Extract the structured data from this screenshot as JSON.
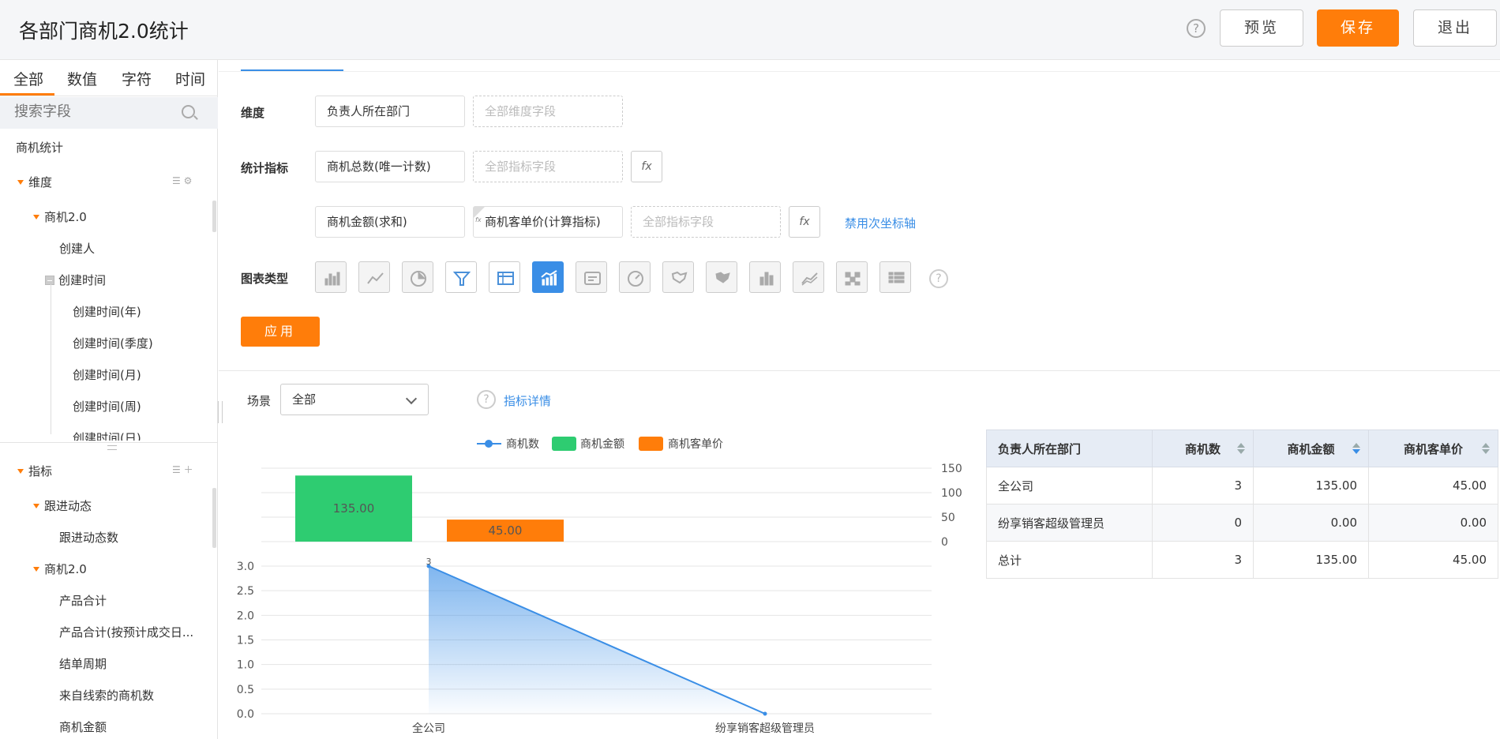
{
  "header": {
    "title": "各部门商机2.0统计",
    "help": "?",
    "preview_label": "预览",
    "save_label": "保存",
    "exit_label": "退出"
  },
  "fields_panel": {
    "tabs": [
      "全部",
      "数值",
      "字符",
      "时间"
    ],
    "search_placeholder": "搜索字段",
    "root": "商机统计",
    "dimension_group": "维度",
    "dim_folder": "商机2.0",
    "dim_items": {
      "creator": "创建人",
      "created_time": "创建时间",
      "ct_year": "创建时间(年)",
      "ct_quarter": "创建时间(季度)",
      "ct_month": "创建时间(月)",
      "ct_week": "创建时间(周)",
      "ct_day": "创建时间(日)"
    },
    "metric_group": "指标",
    "metric_folder_1": "跟进动态",
    "metric_folder_1_items": [
      "跟进动态数"
    ],
    "metric_folder_2": "商机2.0",
    "metric_folder_2_items": [
      "产品合计",
      "产品合计(按预计成交日...",
      "结单周期",
      "来自线索的商机数",
      "商机金额"
    ]
  },
  "config": {
    "dimension_label": "维度",
    "dimension_value": "负责人所在部门",
    "dimension_placeholder": "全部维度字段",
    "metric_label": "统计指标",
    "metric_1": "商机总数(唯一计数)",
    "metric_placeholder": "全部指标字段",
    "metric_2": "商机金额(求和)",
    "metric_3": "商机客单价(计算指标)",
    "fx": "fx",
    "secondary_axis_link": "禁用次坐标轴",
    "chart_type_label": "图表类型",
    "chart_types": [
      "bar-chart-icon",
      "line-chart-icon",
      "pie-chart-icon",
      "funnel-chart-icon",
      "table-chart-icon",
      "combo-chart-icon",
      "card-chart-icon",
      "gauge-chart-icon",
      "map-chart-icon",
      "map2-chart-icon",
      "stacked-bar-icon",
      "area-chart-icon",
      "heatmap-icon",
      "pivot-table-icon"
    ],
    "chart_type_active": "combo-chart-icon",
    "apply_label": "应用"
  },
  "scene": {
    "label": "场景",
    "value": "全部",
    "metric_detail_link": "指标详情"
  },
  "colors": {
    "accent": "#ff7d0a",
    "link": "#3a8ee6",
    "series_count": "#3a8ee6",
    "series_amount": "#2ecc71",
    "series_unit_price": "#ff7d0a"
  },
  "chart_data": {
    "type": "bar",
    "categories": [
      "全公司",
      "纷享销客超级管理员"
    ],
    "series": [
      {
        "name": "商机数",
        "type": "line",
        "values": [
          3,
          0
        ],
        "labels": [
          "3",
          ""
        ]
      },
      {
        "name": "商机金额",
        "type": "bar",
        "values": [
          135.0,
          0.0
        ],
        "labels": [
          "135.00",
          ""
        ]
      },
      {
        "name": "商机客单价",
        "type": "bar",
        "values": [
          45.0,
          0.0
        ],
        "labels": [
          "45.00",
          ""
        ]
      }
    ],
    "bar_axis": {
      "ylim": [
        0,
        150
      ],
      "ticks": [
        "150",
        "100",
        "50",
        "0"
      ]
    },
    "line_axis": {
      "ylim": [
        0,
        3
      ],
      "ticks": [
        "3.0",
        "2.5",
        "2.0",
        "1.5",
        "1.0",
        "0.5",
        "0.0"
      ]
    },
    "legend": "top"
  },
  "table": {
    "headers": [
      "负责人所在部门",
      "商机数",
      "商机金额",
      "商机客单价"
    ],
    "rows": [
      [
        "全公司",
        "3",
        "135.00",
        "45.00"
      ],
      [
        "纷享销客超级管理员",
        "0",
        "0.00",
        "0.00"
      ],
      [
        "总计",
        "3",
        "135.00",
        "45.00"
      ]
    ]
  }
}
